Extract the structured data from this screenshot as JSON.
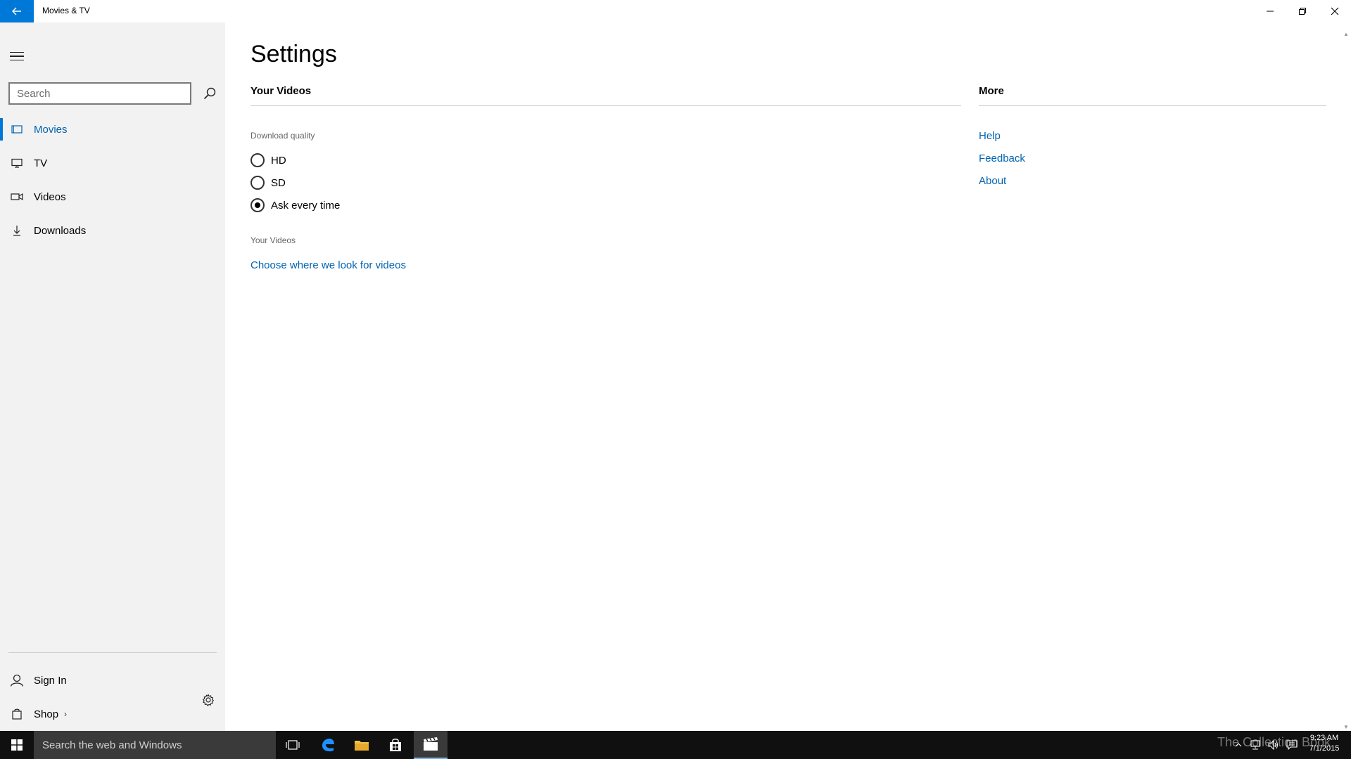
{
  "window": {
    "title": "Movies & TV"
  },
  "sidebar": {
    "search_placeholder": "Search",
    "items": [
      {
        "label": "Movies",
        "icon": "movies-icon"
      },
      {
        "label": "TV",
        "icon": "tv-icon"
      },
      {
        "label": "Videos",
        "icon": "video-camera-icon"
      },
      {
        "label": "Downloads",
        "icon": "download-icon"
      }
    ],
    "active_item": "Movies",
    "sign_in_label": "Sign In",
    "shop_label": "Shop"
  },
  "settings": {
    "title": "Settings",
    "your_videos_header": "Your Videos",
    "download_quality_label": "Download quality",
    "options": [
      {
        "label": "HD",
        "checked": false
      },
      {
        "label": "SD",
        "checked": false
      },
      {
        "label": "Ask every time",
        "checked": true
      }
    ],
    "your_videos_label": "Your Videos",
    "choose_link": "Choose where we look for videos"
  },
  "more": {
    "header": "More",
    "links": [
      "Help",
      "Feedback",
      "About"
    ]
  },
  "taskbar": {
    "search_placeholder": "Search the web and Windows",
    "time": "9:23 AM",
    "date": "7/1/2015",
    "watermark": "The Collection Book"
  },
  "colors": {
    "accent": "#0078d7",
    "link": "#0063b1",
    "sidebar_bg": "#f2f2f2",
    "taskbar_bg": "#101010"
  }
}
